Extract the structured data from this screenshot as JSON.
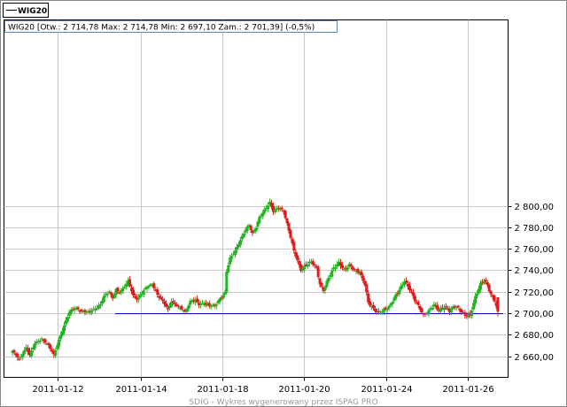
{
  "legend": {
    "label": "WIG20"
  },
  "info_text": "WIG20 [Otw.: 2 714,78  Max: 2 714,78  Min: 2 697,10  Zam.: 2 701,39] (-0,5%)",
  "footer": "SDIG - Wykres wygenerowany przez ISPAG PRO",
  "colors": {
    "up": "#21b421",
    "down": "#e11b1b",
    "grid": "#c8c8c8",
    "reference": "#0000cc",
    "frame": "#000000"
  },
  "chart_data": {
    "type": "candlestick",
    "title": "WIG20",
    "ylim": [
      2648,
      2808
    ],
    "y_ticks": [
      2660,
      2680,
      2700,
      2720,
      2740,
      2760,
      2780,
      2800
    ],
    "y_tick_labels": [
      "2 660,00",
      "2 680,00",
      "2 700,00",
      "2 720,00",
      "2 740,00",
      "2 760,00",
      "2 780,00",
      "2 800,00"
    ],
    "x_tick_labels": [
      "2011-01-12",
      "2011-01-14",
      "2011-01-18",
      "2011-01-20",
      "2011-01-24",
      "2011-01-26"
    ],
    "grid": true,
    "reference_line": {
      "value": 2700
    },
    "last_session": {
      "open": 2714.78,
      "high": 2714.78,
      "low": 2697.1,
      "close": 2701.39,
      "change_pct": -0.5
    },
    "series_path": [
      [
        0,
        2665
      ],
      [
        4,
        2657
      ],
      [
        8,
        2668
      ],
      [
        10,
        2661
      ],
      [
        13,
        2672
      ],
      [
        17,
        2676
      ],
      [
        21,
        2670
      ],
      [
        24,
        2661
      ],
      [
        27,
        2675
      ],
      [
        29,
        2684
      ],
      [
        31,
        2693
      ],
      [
        33,
        2701
      ],
      [
        36,
        2705
      ],
      [
        40,
        2702
      ],
      [
        44,
        2701
      ],
      [
        48,
        2704
      ],
      [
        51,
        2708
      ],
      [
        53,
        2716
      ],
      [
        56,
        2720
      ],
      [
        58,
        2714
      ],
      [
        60,
        2722
      ],
      [
        62,
        2719
      ],
      [
        65,
        2725
      ],
      [
        67,
        2730
      ],
      [
        70,
        2716
      ],
      [
        72,
        2713
      ],
      [
        75,
        2719
      ],
      [
        78,
        2725
      ],
      [
        81,
        2727
      ],
      [
        84,
        2717
      ],
      [
        86,
        2713
      ],
      [
        88,
        2709
      ],
      [
        90,
        2703
      ],
      [
        92,
        2711
      ],
      [
        95,
        2707
      ],
      [
        98,
        2704
      ],
      [
        100,
        2701
      ],
      [
        103,
        2711
      ],
      [
        106,
        2712
      ],
      [
        108,
        2708
      ],
      [
        111,
        2709
      ],
      [
        114,
        2707
      ],
      [
        117,
        2707
      ],
      [
        120,
        2713
      ],
      [
        123,
        2719
      ],
      [
        124,
        2739
      ],
      [
        126,
        2751
      ],
      [
        129,
        2758
      ],
      [
        132,
        2768
      ],
      [
        135,
        2778
      ],
      [
        137,
        2782
      ],
      [
        139,
        2774
      ],
      [
        141,
        2780
      ],
      [
        143,
        2789
      ],
      [
        146,
        2796
      ],
      [
        149,
        2803
      ],
      [
        151,
        2795
      ],
      [
        154,
        2798
      ],
      [
        157,
        2795
      ],
      [
        159,
        2783
      ],
      [
        161,
        2771
      ],
      [
        163,
        2758
      ],
      [
        165,
        2749
      ],
      [
        167,
        2740
      ],
      [
        170,
        2745
      ],
      [
        173,
        2748
      ],
      [
        176,
        2742
      ],
      [
        178,
        2727
      ],
      [
        180,
        2721
      ],
      [
        183,
        2733
      ],
      [
        186,
        2742
      ],
      [
        189,
        2747
      ],
      [
        192,
        2740
      ],
      [
        195,
        2745
      ],
      [
        198,
        2740
      ],
      [
        201,
        2738
      ],
      [
        204,
        2727
      ],
      [
        206,
        2710
      ],
      [
        209,
        2704
      ],
      [
        212,
        2700
      ],
      [
        215,
        2703
      ],
      [
        218,
        2706
      ],
      [
        221,
        2714
      ],
      [
        224,
        2722
      ],
      [
        227,
        2730
      ],
      [
        230,
        2722
      ],
      [
        233,
        2712
      ],
      [
        236,
        2704
      ],
      [
        238,
        2698
      ],
      [
        241,
        2702
      ],
      [
        244,
        2708
      ],
      [
        247,
        2702
      ],
      [
        250,
        2706
      ],
      [
        253,
        2702
      ],
      [
        256,
        2707
      ],
      [
        259,
        2703
      ],
      [
        262,
        2698
      ],
      [
        265,
        2698
      ],
      [
        268,
        2715
      ],
      [
        271,
        2727
      ],
      [
        273,
        2731
      ],
      [
        275,
        2726
      ],
      [
        277,
        2717
      ],
      [
        279,
        2712
      ],
      [
        281,
        2702
      ]
    ]
  }
}
